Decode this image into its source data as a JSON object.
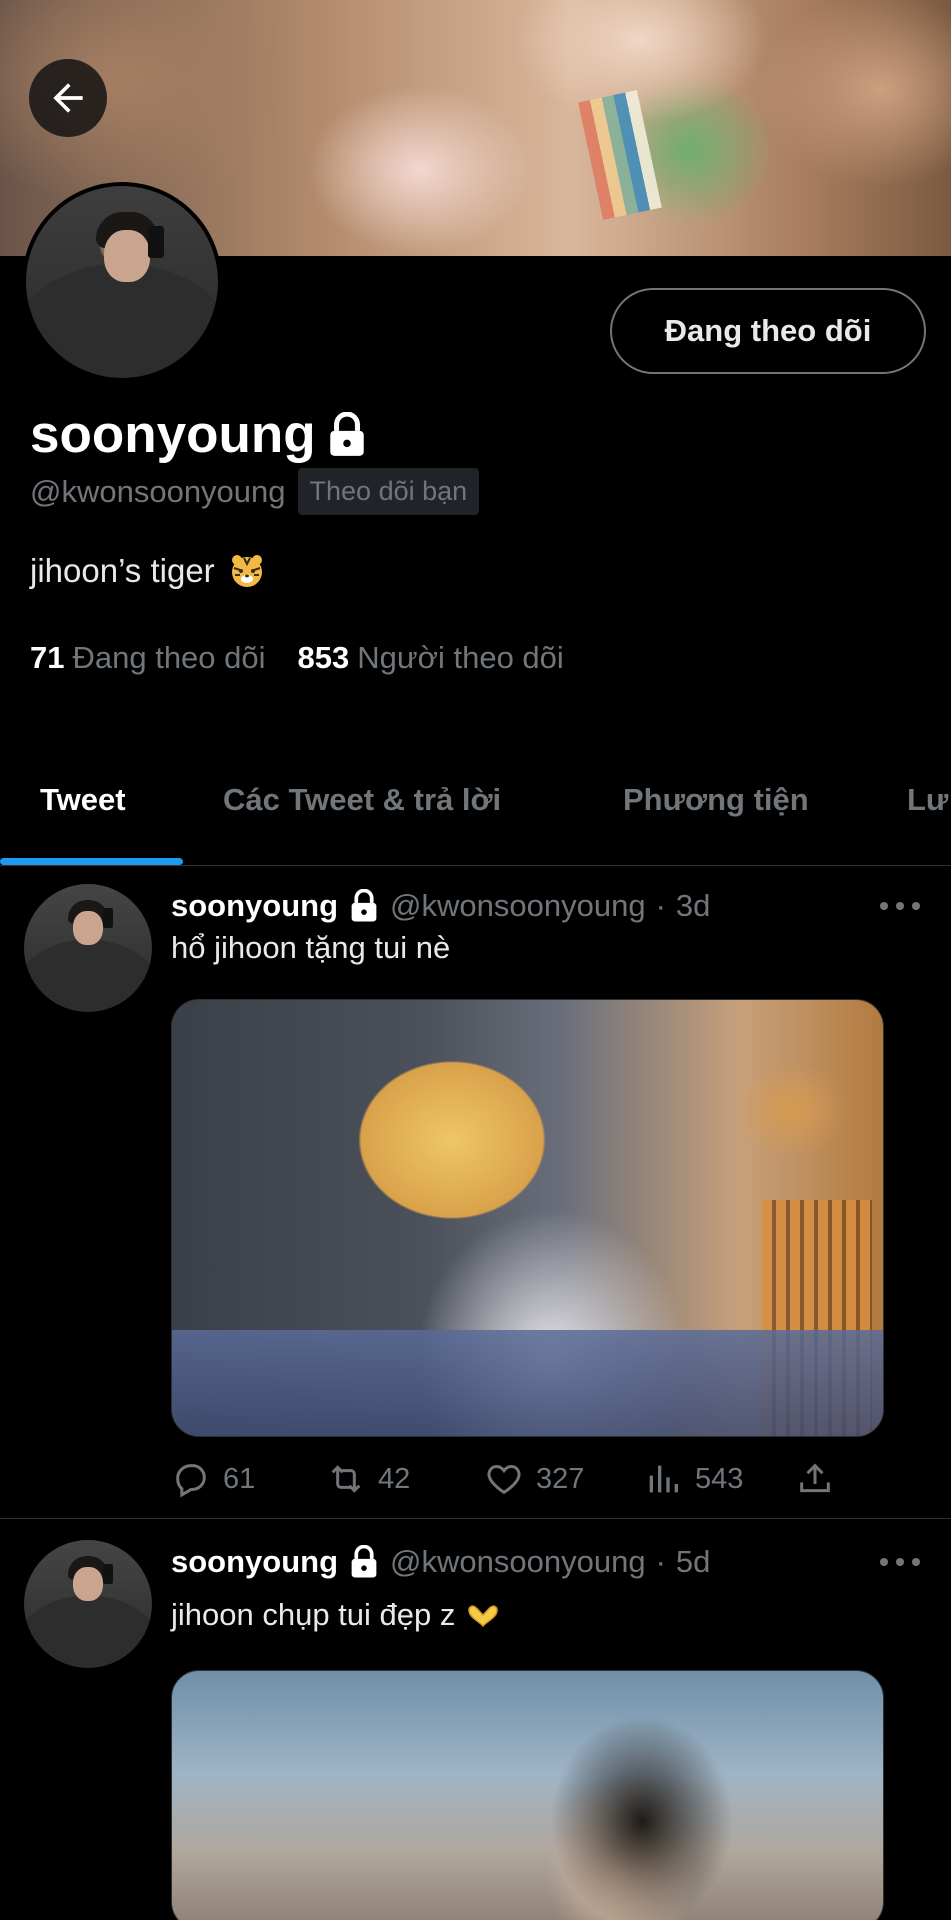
{
  "profile": {
    "display_name": "soonyoung",
    "handle": "@kwonsoonyoung",
    "follows_you": "Theo dõi bạn",
    "bio": "jihoon’s tiger",
    "bio_emoji": "tiger-face-icon",
    "follow_button": "Đang theo dõi",
    "following_count": "71",
    "following_label": "Đang theo dõi",
    "followers_count": "853",
    "followers_label": "Người theo dõi"
  },
  "tabs": [
    {
      "label": "Tweet",
      "active": true
    },
    {
      "label": "Các Tweet & trả lời",
      "active": false
    },
    {
      "label": "Phương tiện",
      "active": false
    },
    {
      "label": "Lư",
      "active": false
    }
  ],
  "tweets": [
    {
      "name": "soonyoung",
      "handle": "@kwonsoonyoung",
      "dot": "·",
      "time": "3d",
      "text": "hổ jihoon tặng tui nè",
      "replies": "61",
      "retweets": "42",
      "likes": "327",
      "views": "543"
    },
    {
      "name": "soonyoung",
      "handle": "@kwonsoonyoung",
      "dot": "·",
      "time": "5d",
      "text": "jihoon chụp tui đẹp z",
      "text_emoji": "heart-hands-icon"
    }
  ],
  "colors": {
    "background": "#000000",
    "text_primary": "#e7e9ea",
    "text_secondary": "#71767b",
    "accent": "#1d9bf0",
    "divider": "#2f3336"
  }
}
